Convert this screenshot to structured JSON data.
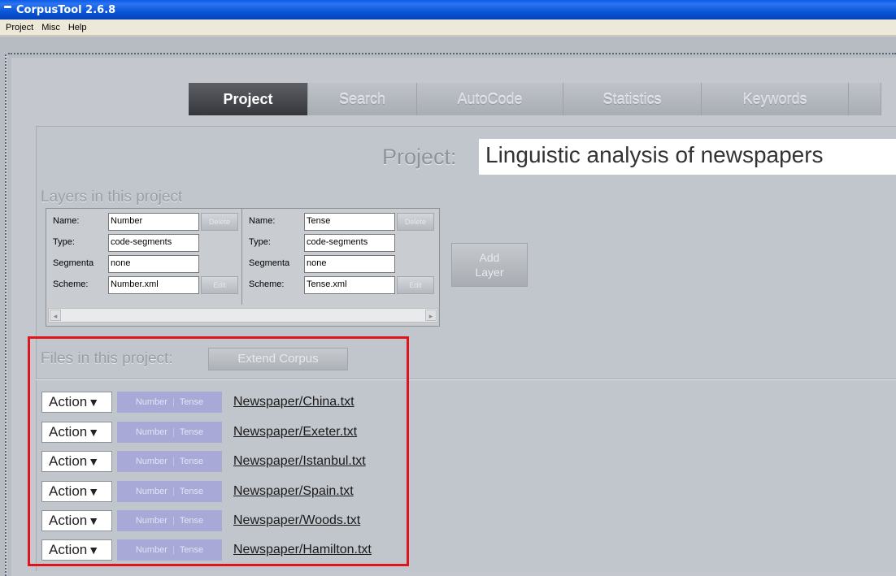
{
  "window": {
    "title": "CorpusTool 2.6.8"
  },
  "menu": [
    "Project",
    "Misc",
    "Help"
  ],
  "tabs": [
    {
      "label": "Project",
      "active": true
    },
    {
      "label": "Search"
    },
    {
      "label": "AutoCode"
    },
    {
      "label": "Statistics"
    },
    {
      "label": "Keywords"
    }
  ],
  "project": {
    "label": "Project:",
    "name": "Linguistic analysis of newspapers"
  },
  "layers": {
    "section_title": "Layers in this project",
    "items": [
      {
        "name_label": "Name:",
        "name": "Number",
        "delete_label": "Delete",
        "type_label": "Type:",
        "type": "code-segments",
        "seg_label": "Segmenta",
        "segmentation": "none",
        "scheme_label": "Scheme:",
        "scheme": "Number.xml",
        "edit_label": "Edit"
      },
      {
        "name_label": "Name:",
        "name": "Tense",
        "delete_label": "Delete",
        "type_label": "Type:",
        "type": "code-segments",
        "seg_label": "Segmenta",
        "segmentation": "none",
        "scheme_label": "Scheme:",
        "scheme": "Tense.xml",
        "edit_label": "Edit"
      }
    ],
    "add_label_1": "Add",
    "add_label_2": "Layer"
  },
  "files": {
    "section_title": "Files in this project:",
    "extend_label": "Extend Corpus",
    "action_label": "Action",
    "action_caret": "▼",
    "tag_1": "Number",
    "tag_2": "Tense",
    "tag_sep": "|",
    "items": [
      "Newspaper/China.txt",
      "Newspaper/Exeter.txt",
      "Newspaper/Istanbul.txt",
      "Newspaper/Spain.txt",
      "Newspaper/Woods.txt",
      "Newspaper/Hamilton.txt"
    ]
  },
  "colors": {
    "highlight": "#e0141d",
    "active_tab": "#44464b",
    "tag_bg": "#a9a9d8"
  }
}
